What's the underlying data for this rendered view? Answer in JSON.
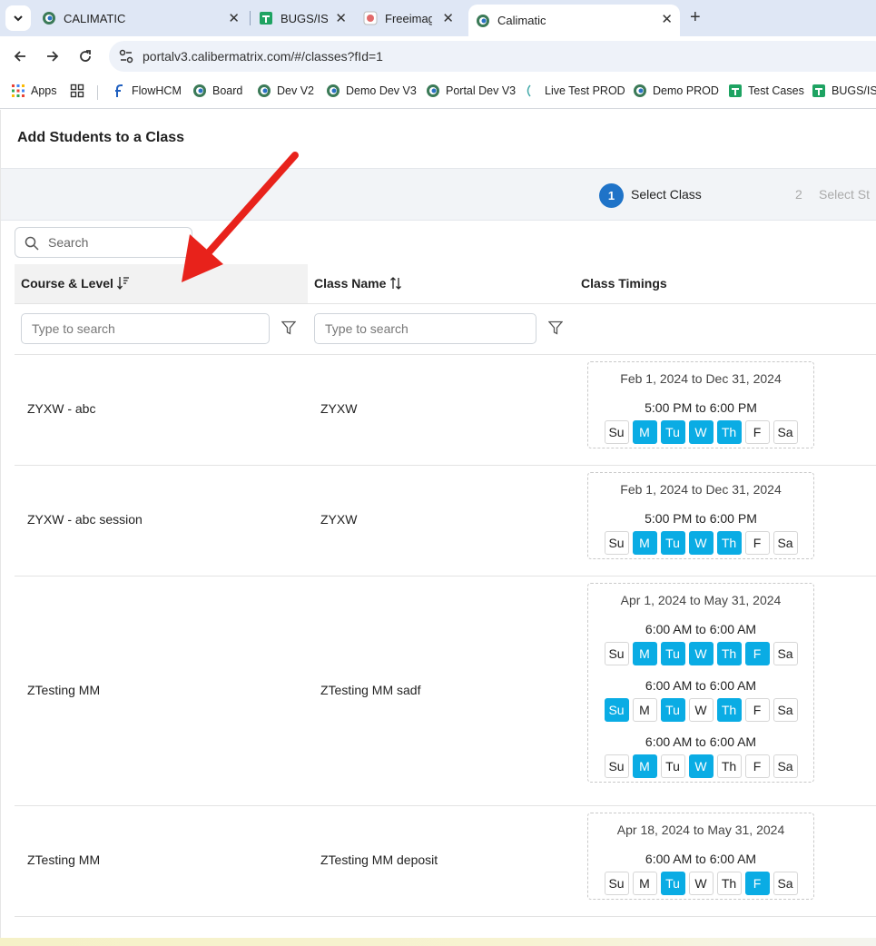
{
  "browser": {
    "tabs": [
      {
        "label": "CALIMATIC",
        "icon": "calimatic-icon"
      },
      {
        "label": "BUGS/ISS",
        "icon": "google-sheets-icon"
      },
      {
        "label": "Freeimag",
        "icon": "freeimage-icon"
      },
      {
        "label": "Calimatic",
        "icon": "calimatic-icon"
      }
    ],
    "url": "portalv3.calibermatrix.com/#/classes?fId=1",
    "bookmarks": [
      {
        "label": "Apps"
      },
      {
        "label": "FlowHCM"
      },
      {
        "label": "Board"
      },
      {
        "label": "Dev V2"
      },
      {
        "label": "Demo Dev V3"
      },
      {
        "label": "Portal Dev V3"
      },
      {
        "label": "Live Test PROD"
      },
      {
        "label": "Demo PROD"
      },
      {
        "label": "Test Cases"
      },
      {
        "label": "BUGS/ISS"
      }
    ]
  },
  "page": {
    "title": "Add Students to a Class",
    "steps": [
      {
        "number": "1",
        "label": "Select Class"
      },
      {
        "number": "2",
        "label": "Select St"
      }
    ],
    "search_placeholder": "Search",
    "columns": {
      "course": "Course & Level",
      "class_name": "Class Name",
      "timings": "Class Timings"
    },
    "filter_placeholder": "Type to search",
    "day_labels": [
      "Su",
      "M",
      "Tu",
      "W",
      "Th",
      "F",
      "Sa"
    ],
    "accent_color": "#0aace4",
    "rows": [
      {
        "course": "ZYXW - abc",
        "class_name": "ZYXW",
        "date_range": "Feb 1, 2024 to Dec 31, 2024",
        "schedules": [
          {
            "time": "5:00 PM to 6:00 PM",
            "active_days": [
              "M",
              "Tu",
              "W",
              "Th"
            ]
          }
        ]
      },
      {
        "course": "ZYXW - abc session",
        "class_name": "ZYXW",
        "date_range": "Feb 1, 2024 to Dec 31, 2024",
        "schedules": [
          {
            "time": "5:00 PM to 6:00 PM",
            "active_days": [
              "M",
              "Tu",
              "W",
              "Th"
            ]
          }
        ]
      },
      {
        "course": "ZTesting MM",
        "class_name": "ZTesting MM sadf",
        "date_range": "Apr 1, 2024 to May 31, 2024",
        "schedules": [
          {
            "time": "6:00 AM to 6:00 AM",
            "active_days": [
              "M",
              "Tu",
              "W",
              "Th",
              "F"
            ]
          },
          {
            "time": "6:00 AM to 6:00 AM",
            "active_days": [
              "Su",
              "Tu",
              "Th"
            ]
          },
          {
            "time": "6:00 AM to 6:00 AM",
            "active_days": [
              "M",
              "W"
            ]
          }
        ]
      },
      {
        "course": "ZTesting MM",
        "class_name": "ZTesting MM deposit",
        "date_range": "Apr 18, 2024 to May 31, 2024",
        "schedules": [
          {
            "time": "6:00 AM to 6:00 AM",
            "active_days": [
              "Tu",
              "F"
            ]
          }
        ]
      }
    ]
  }
}
